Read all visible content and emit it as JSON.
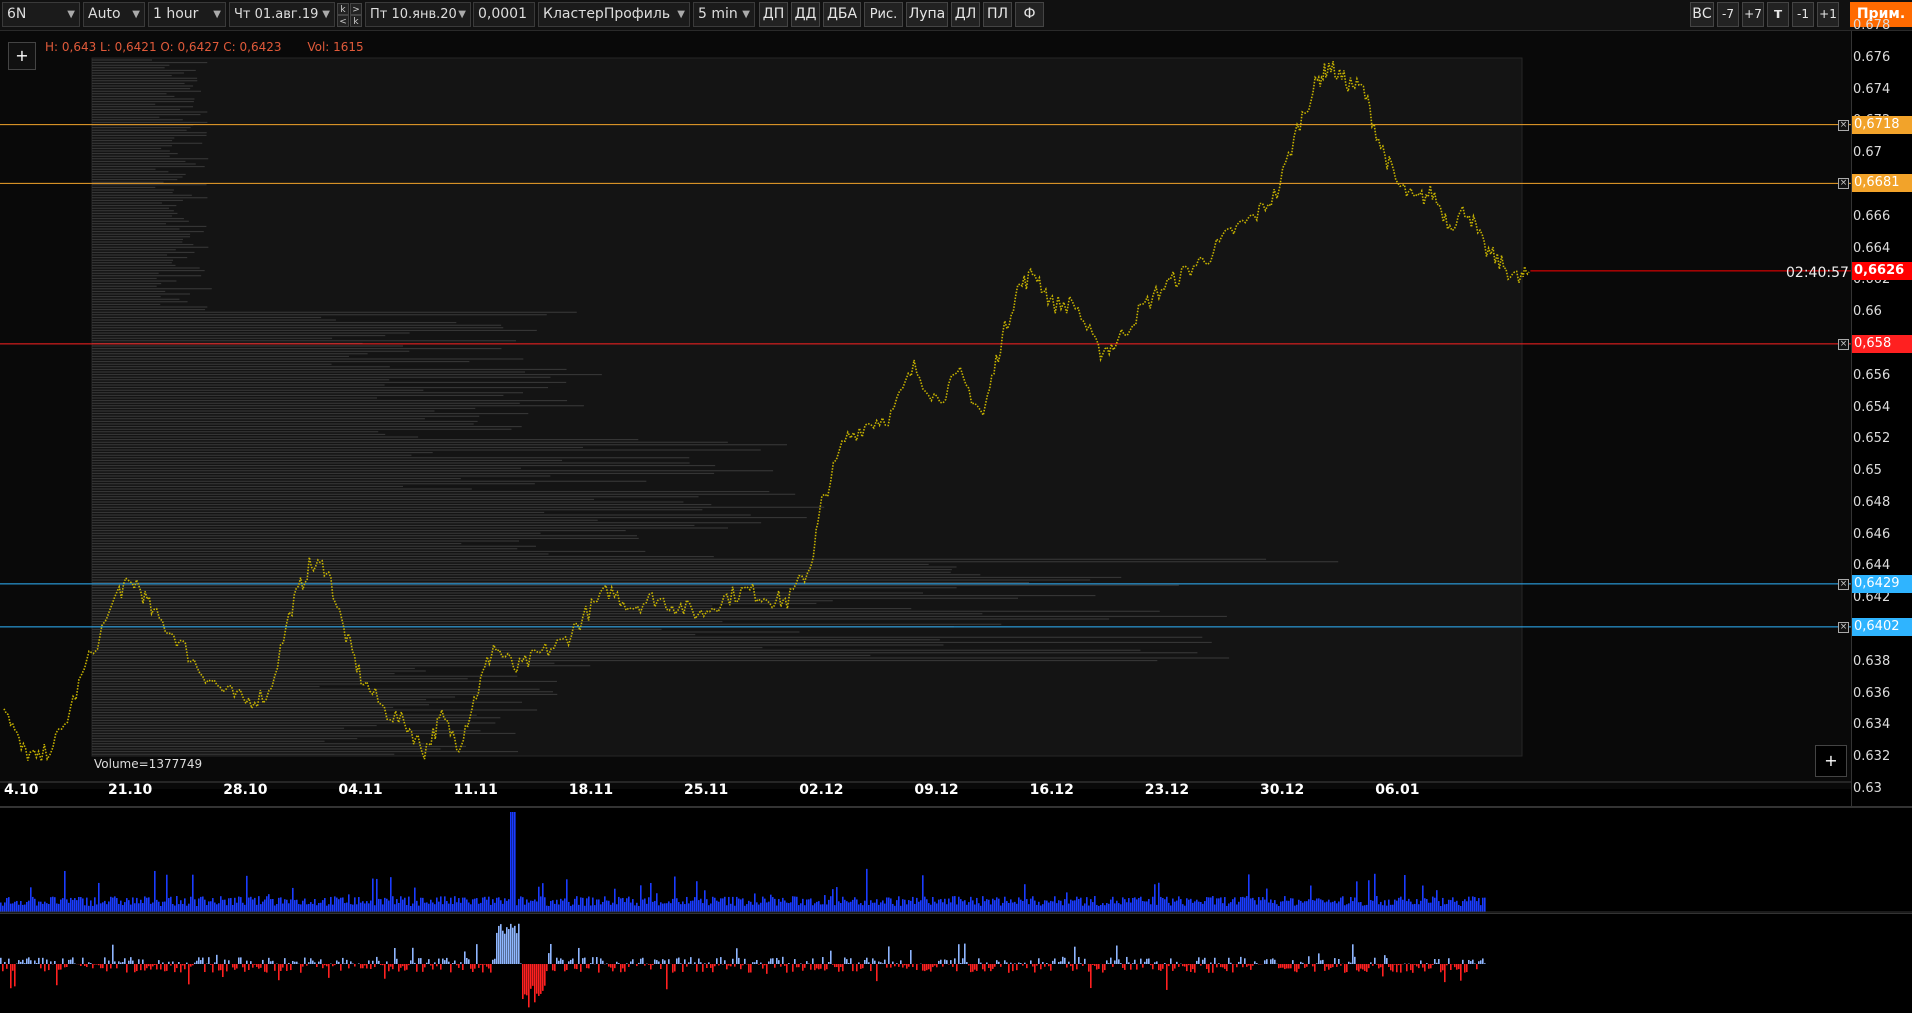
{
  "toolbar": {
    "symbol": "6N",
    "scale_mode": "Auto",
    "timeframe": "1 hour",
    "date_from": "Чт 01.авг.19",
    "date_to": "Пт 10.янв.20",
    "tick_size": "0,0001",
    "chart_type": "КластерПрофиль",
    "cluster_period": "5 min",
    "k_buttons": [
      "k",
      ">",
      "<",
      "k"
    ],
    "buttons": [
      "ДП",
      "ДД",
      "ДБА",
      "Рис.",
      "Лупа",
      "ДЛ",
      "ПЛ",
      "Ф"
    ],
    "right_buttons": [
      "ВС",
      "-7",
      "+7",
      "т",
      "-1",
      "+1"
    ],
    "apply_label": "Прим."
  },
  "legend": {
    "ohlc": "H: 0,643 L: 0,6421 O: 0,6427 C: 0,6423",
    "volume": "Vol: 1615",
    "plus": "+"
  },
  "chart": {
    "volume_total": "Volume=1377749",
    "countdown": "02:40:57",
    "current_price": "0,6626",
    "plus": "+",
    "x_glyph": "×"
  },
  "chart_data": {
    "type": "line",
    "x_tick_labels": [
      "4.10",
      "21.10",
      "28.10",
      "04.11",
      "11.11",
      "18.11",
      "25.11",
      "02.12",
      "09.12",
      "16.12",
      "23.12",
      "30.12",
      "06.01"
    ],
    "y_tick_labels": [
      "0.678",
      "0.676",
      "0.674",
      "0.672",
      "0.67",
      "0.668",
      "0.666",
      "0.664",
      "0.662",
      "0.66",
      "0.658",
      "0.656",
      "0.654",
      "0.652",
      "0.65",
      "0.648",
      "0.646",
      "0.644",
      "0.642",
      "0.64",
      "0.638",
      "0.636",
      "0.634",
      "0.632",
      "0.63"
    ],
    "ylim": [
      0.6305,
      0.6775
    ],
    "price_path": [
      [
        0,
        0.6355
      ],
      [
        0.3,
        0.6325
      ],
      [
        0.6,
        0.6318
      ],
      [
        1.0,
        0.6335
      ],
      [
        1.4,
        0.6375
      ],
      [
        2.0,
        0.6425
      ],
      [
        2.3,
        0.643
      ],
      [
        2.6,
        0.641
      ],
      [
        3.0,
        0.6395
      ],
      [
        3.4,
        0.6375
      ],
      [
        3.8,
        0.6362
      ],
      [
        4.2,
        0.6355
      ],
      [
        4.6,
        0.636
      ],
      [
        5.0,
        0.6415
      ],
      [
        5.3,
        0.644
      ],
      [
        5.6,
        0.644
      ],
      [
        5.9,
        0.64
      ],
      [
        6.2,
        0.637
      ],
      [
        6.6,
        0.635
      ],
      [
        7.0,
        0.634
      ],
      [
        7.3,
        0.6324
      ],
      [
        7.6,
        0.6345
      ],
      [
        7.9,
        0.6328
      ],
      [
        8.2,
        0.636
      ],
      [
        8.5,
        0.639
      ],
      [
        8.9,
        0.6375
      ],
      [
        9.3,
        0.6385
      ],
      [
        9.7,
        0.6392
      ],
      [
        10.1,
        0.641
      ],
      [
        10.5,
        0.6425
      ],
      [
        10.9,
        0.6415
      ],
      [
        11.3,
        0.642
      ],
      [
        11.7,
        0.6415
      ],
      [
        12.1,
        0.641
      ],
      [
        12.5,
        0.642
      ],
      [
        12.9,
        0.6425
      ],
      [
        13.3,
        0.642
      ],
      [
        13.6,
        0.6418
      ],
      [
        14.0,
        0.644
      ],
      [
        14.2,
        0.648
      ],
      [
        14.6,
        0.652
      ],
      [
        15.0,
        0.653
      ],
      [
        15.4,
        0.6535
      ],
      [
        15.8,
        0.6565
      ],
      [
        16.2,
        0.6545
      ],
      [
        16.6,
        0.656
      ],
      [
        17.0,
        0.6535
      ],
      [
        17.3,
        0.658
      ],
      [
        17.6,
        0.6615
      ],
      [
        17.9,
        0.6625
      ],
      [
        18.2,
        0.6605
      ],
      [
        18.6,
        0.6605
      ],
      [
        19.0,
        0.6575
      ],
      [
        19.3,
        0.658
      ],
      [
        19.7,
        0.66
      ],
      [
        20.1,
        0.6615
      ],
      [
        20.5,
        0.6625
      ],
      [
        20.9,
        0.6635
      ],
      [
        21.3,
        0.665
      ],
      [
        21.7,
        0.666
      ],
      [
        22.1,
        0.6675
      ],
      [
        22.5,
        0.672
      ],
      [
        22.8,
        0.6745
      ],
      [
        23.0,
        0.6755
      ],
      [
        23.3,
        0.6745
      ],
      [
        23.6,
        0.674
      ],
      [
        23.9,
        0.6705
      ],
      [
        24.2,
        0.668
      ],
      [
        24.5,
        0.667
      ],
      [
        24.8,
        0.6675
      ],
      [
        25.1,
        0.6655
      ],
      [
        25.4,
        0.6665
      ],
      [
        25.7,
        0.664
      ],
      [
        26.0,
        0.663
      ],
      [
        26.3,
        0.662
      ],
      [
        26.5,
        0.6626
      ]
    ],
    "levels": [
      {
        "price": "0,6718",
        "color": "#f2a32a"
      },
      {
        "price": "0,6681",
        "color": "#f2a32a"
      },
      {
        "price": "0,658",
        "color": "#ff2020"
      },
      {
        "price": "0,6429",
        "color": "#2fb4ff"
      },
      {
        "price": "0,6402",
        "color": "#2fb4ff"
      }
    ],
    "series_colors": {
      "price": "#c8b400",
      "current_price_tag": "#ff0000",
      "volume_bars": "#1a3cff",
      "delta_positive": "#8fb6ff",
      "delta_negative": "#ff2020"
    }
  }
}
